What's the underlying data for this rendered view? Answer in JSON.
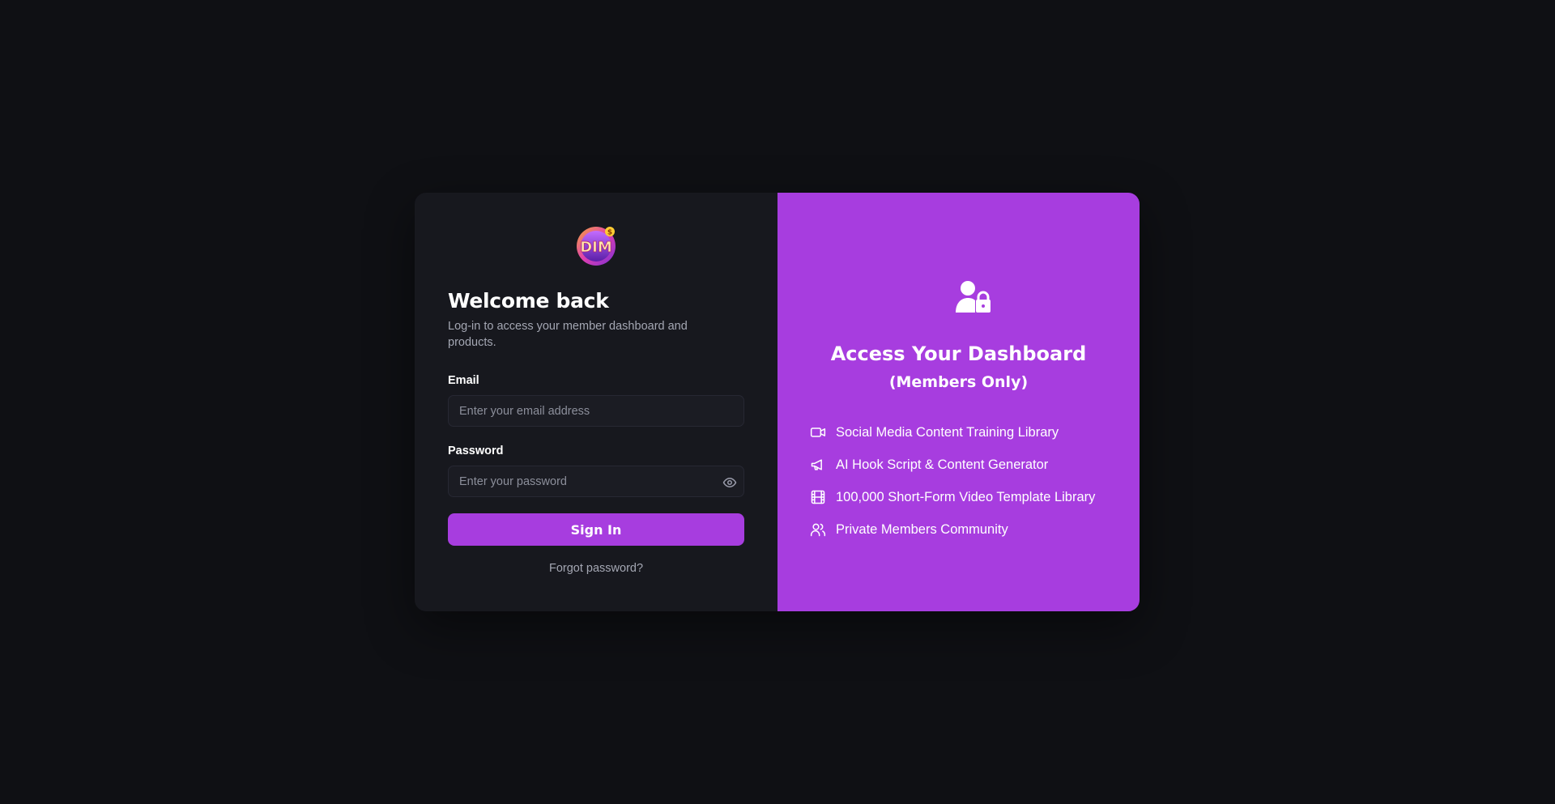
{
  "login": {
    "logo_text": "DIM",
    "title": "Welcome back",
    "subtitle": "Log-in to access your member dashboard and products.",
    "email_label": "Email",
    "email_placeholder": "Enter your email address",
    "password_label": "Password",
    "password_placeholder": "Enter your password",
    "signin_label": "Sign In",
    "forgot_label": "Forgot password?"
  },
  "promo": {
    "title": "Access Your Dashboard",
    "subtitle": "(Members Only)",
    "features": [
      {
        "icon": "video-icon",
        "label": "Social Media Content Training Library"
      },
      {
        "icon": "megaphone-icon",
        "label": "AI Hook Script & Content Generator"
      },
      {
        "icon": "film-icon",
        "label": "100,000 Short-Form Video Template Library"
      },
      {
        "icon": "users-icon",
        "label": "Private Members Community"
      }
    ]
  },
  "colors": {
    "page_bg": "#0f1014",
    "card_left_bg": "#17181e",
    "accent": "#a73ddf",
    "muted_text": "#a4a7b3"
  }
}
